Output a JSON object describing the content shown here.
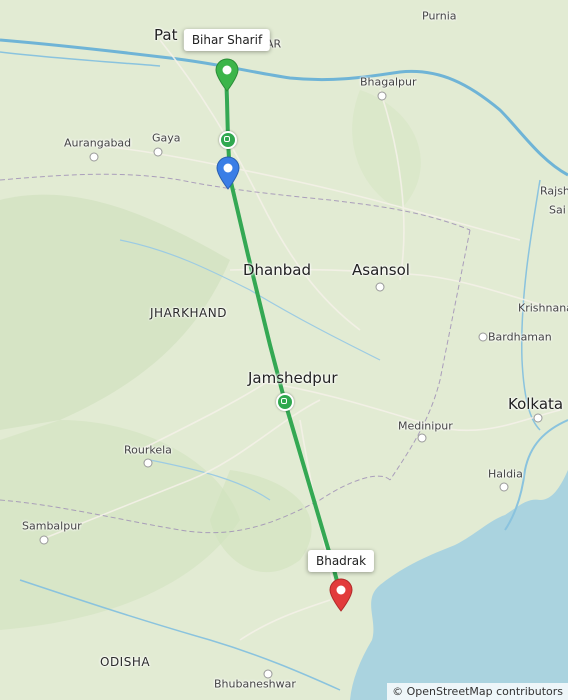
{
  "map": {
    "labels": {
      "patna": "Pat",
      "bihar_frag": "AR",
      "purnia": "Purnia",
      "bhagalpur": "Bhagalpur",
      "aurangabad": "Aurangabad",
      "gaya": "Gaya",
      "rajsh": "Rajsh",
      "dhanbad": "Dhanbad",
      "asansol": "Asansol",
      "jharkhand": "JHARKHAND",
      "krishnanagar": "Krishnana",
      "bardhaman": "Bardhaman",
      "jamshedpur": "Jamshedpur",
      "kolkata": "Kolkata",
      "medinipur": "Medinipur",
      "rourkela": "Rourkela",
      "haldia": "Haldia",
      "sambalpur": "Sambalpur",
      "odisha": "ODISHA",
      "bhubaneshwar": "Bhubaneshwar",
      "sai": "Sai"
    },
    "popups": {
      "origin": "Bihar Sharif",
      "destination": "Bhadrak"
    },
    "markers": {
      "origin_color": "#3cb54a",
      "current_color": "#3a7ee6",
      "destination_color": "#e23b3b",
      "route_color": "#34a853"
    },
    "attribution": "© OpenStreetMap contributors"
  }
}
